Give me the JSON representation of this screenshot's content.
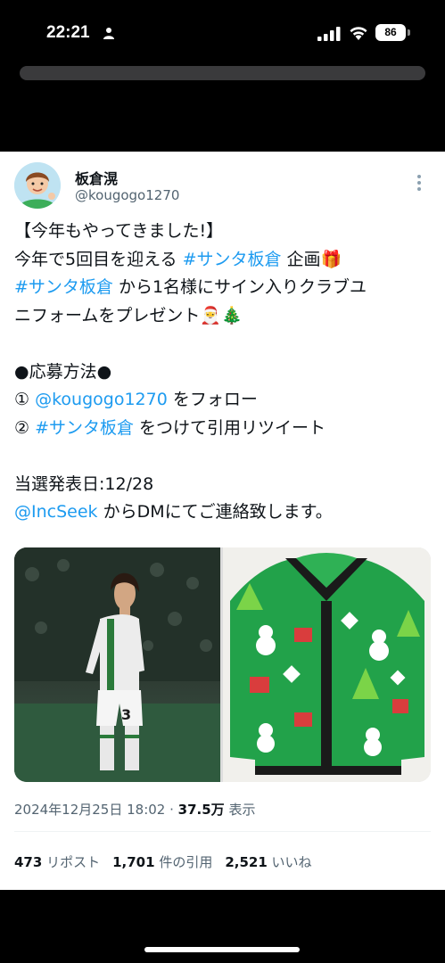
{
  "status_bar": {
    "time": "22:21",
    "battery": "86",
    "icons": [
      "person-icon",
      "signal-icon",
      "wifi-icon"
    ]
  },
  "tweet": {
    "display_name": "板倉滉",
    "handle": "@kougogo1270",
    "line1": "【今年もやってきました!】",
    "line2_a": "今年で5回目を迎える ",
    "line2_tag": "#サンタ板倉",
    "line2_b": " 企画🎁",
    "line3_tag": "#サンタ板倉",
    "line3_b": " から1名様にサイン入りクラブユ",
    "line4": "ニフォームをプレゼント🎅🎄",
    "line5": "●応募方法●",
    "line6_a": "① ",
    "line6_mention": "@kougogo1270",
    "line6_b": " をフォロー",
    "line7_a": "② ",
    "line7_tag": "#サンタ板倉",
    "line7_b": " をつけて引用リツイート",
    "line8": "当選発表日:12/28",
    "line9_mention": "@IncSeek",
    "line9_b": " からDMにてご連絡致します。",
    "timestamp": "2024年12月25日 18:02 · ",
    "views_value": "37.5万",
    "views_label": " 表示",
    "reposts_value": "473",
    "reposts_label": " リポスト",
    "quotes_value": "1,701",
    "quotes_label": " 件の引用",
    "likes_value": "2,521",
    "likes_label": " いいね",
    "jersey_number": "3",
    "colors": {
      "link": "#1d9bf0",
      "text": "#0f1419",
      "secondary": "#536471"
    }
  }
}
